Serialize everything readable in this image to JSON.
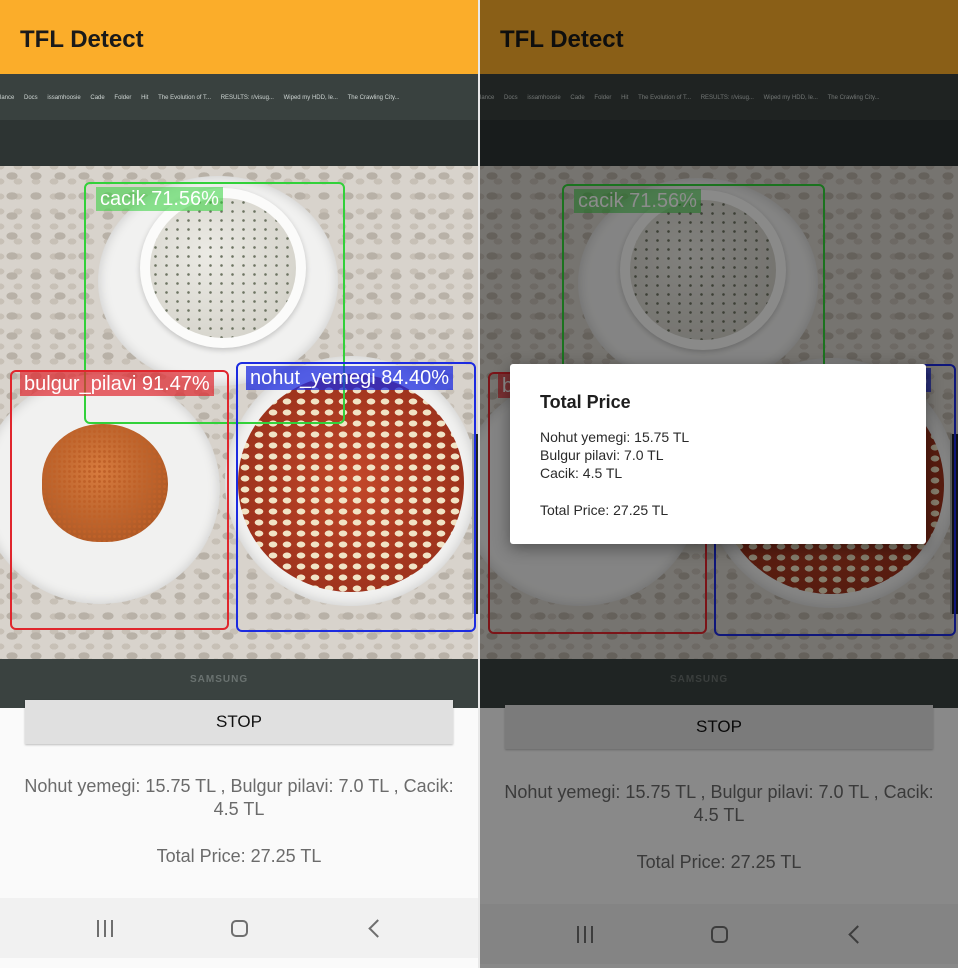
{
  "app": {
    "title": "TFL Detect"
  },
  "browser_bookmarks": [
    "lance",
    "Docs",
    "issamhoosie",
    "Cade",
    "Folder",
    "Hit",
    "The Evolution of T...",
    "RESULTS: r/visug...",
    "Wiped my HDD, le...",
    "The Crawling City..."
  ],
  "camera": {
    "device_brand": "SAMSUNG"
  },
  "detections": [
    {
      "label": "cacik 71.56%",
      "color": "#32d13a"
    },
    {
      "label": "bulgur_pilavi 91.47%",
      "color": "#e0262d"
    },
    {
      "label": "nohut_yemegi 84.40%",
      "color": "#1c2be0"
    }
  ],
  "controls": {
    "stop_label": "STOP"
  },
  "results": {
    "items_line": "Nohut yemegi: 15.75 TL , Bulgur pilavi: 7.0 TL , Cacik: 4.5 TL",
    "total_line": "Total Price: 27.25 TL"
  },
  "dialog": {
    "title": "Total Price",
    "lines": [
      "Nohut yemegi: 15.75 TL",
      "Bulgur pilavi: 7.0 TL",
      "Cacik: 4.5 TL"
    ],
    "total": "Total Price: 27.25 TL"
  },
  "navigation": {
    "recents": "recents-icon",
    "home": "home-icon",
    "back": "back-icon"
  }
}
